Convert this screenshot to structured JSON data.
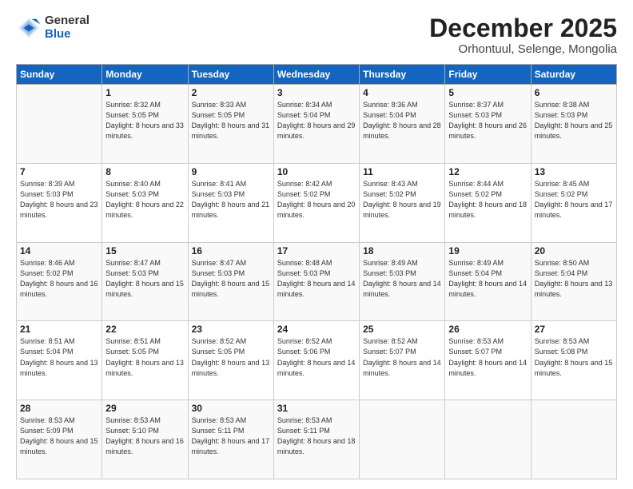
{
  "header": {
    "logo": {
      "line1": "General",
      "line2": "Blue"
    },
    "title": "December 2025",
    "subtitle": "Orhontuul, Selenge, Mongolia"
  },
  "days_header": [
    "Sunday",
    "Monday",
    "Tuesday",
    "Wednesday",
    "Thursday",
    "Friday",
    "Saturday"
  ],
  "weeks": [
    [
      {
        "day": "",
        "sunrise": "",
        "sunset": "",
        "daylight": ""
      },
      {
        "day": "1",
        "sunrise": "Sunrise: 8:32 AM",
        "sunset": "Sunset: 5:05 PM",
        "daylight": "Daylight: 8 hours and 33 minutes."
      },
      {
        "day": "2",
        "sunrise": "Sunrise: 8:33 AM",
        "sunset": "Sunset: 5:05 PM",
        "daylight": "Daylight: 8 hours and 31 minutes."
      },
      {
        "day": "3",
        "sunrise": "Sunrise: 8:34 AM",
        "sunset": "Sunset: 5:04 PM",
        "daylight": "Daylight: 8 hours and 29 minutes."
      },
      {
        "day": "4",
        "sunrise": "Sunrise: 8:36 AM",
        "sunset": "Sunset: 5:04 PM",
        "daylight": "Daylight: 8 hours and 28 minutes."
      },
      {
        "day": "5",
        "sunrise": "Sunrise: 8:37 AM",
        "sunset": "Sunset: 5:03 PM",
        "daylight": "Daylight: 8 hours and 26 minutes."
      },
      {
        "day": "6",
        "sunrise": "Sunrise: 8:38 AM",
        "sunset": "Sunset: 5:03 PM",
        "daylight": "Daylight: 8 hours and 25 minutes."
      }
    ],
    [
      {
        "day": "7",
        "sunrise": "Sunrise: 8:39 AM",
        "sunset": "Sunset: 5:03 PM",
        "daylight": "Daylight: 8 hours and 23 minutes."
      },
      {
        "day": "8",
        "sunrise": "Sunrise: 8:40 AM",
        "sunset": "Sunset: 5:03 PM",
        "daylight": "Daylight: 8 hours and 22 minutes."
      },
      {
        "day": "9",
        "sunrise": "Sunrise: 8:41 AM",
        "sunset": "Sunset: 5:03 PM",
        "daylight": "Daylight: 8 hours and 21 minutes."
      },
      {
        "day": "10",
        "sunrise": "Sunrise: 8:42 AM",
        "sunset": "Sunset: 5:02 PM",
        "daylight": "Daylight: 8 hours and 20 minutes."
      },
      {
        "day": "11",
        "sunrise": "Sunrise: 8:43 AM",
        "sunset": "Sunset: 5:02 PM",
        "daylight": "Daylight: 8 hours and 19 minutes."
      },
      {
        "day": "12",
        "sunrise": "Sunrise: 8:44 AM",
        "sunset": "Sunset: 5:02 PM",
        "daylight": "Daylight: 8 hours and 18 minutes."
      },
      {
        "day": "13",
        "sunrise": "Sunrise: 8:45 AM",
        "sunset": "Sunset: 5:02 PM",
        "daylight": "Daylight: 8 hours and 17 minutes."
      }
    ],
    [
      {
        "day": "14",
        "sunrise": "Sunrise: 8:46 AM",
        "sunset": "Sunset: 5:02 PM",
        "daylight": "Daylight: 8 hours and 16 minutes."
      },
      {
        "day": "15",
        "sunrise": "Sunrise: 8:47 AM",
        "sunset": "Sunset: 5:03 PM",
        "daylight": "Daylight: 8 hours and 15 minutes."
      },
      {
        "day": "16",
        "sunrise": "Sunrise: 8:47 AM",
        "sunset": "Sunset: 5:03 PM",
        "daylight": "Daylight: 8 hours and 15 minutes."
      },
      {
        "day": "17",
        "sunrise": "Sunrise: 8:48 AM",
        "sunset": "Sunset: 5:03 PM",
        "daylight": "Daylight: 8 hours and 14 minutes."
      },
      {
        "day": "18",
        "sunrise": "Sunrise: 8:49 AM",
        "sunset": "Sunset: 5:03 PM",
        "daylight": "Daylight: 8 hours and 14 minutes."
      },
      {
        "day": "19",
        "sunrise": "Sunrise: 8:49 AM",
        "sunset": "Sunset: 5:04 PM",
        "daylight": "Daylight: 8 hours and 14 minutes."
      },
      {
        "day": "20",
        "sunrise": "Sunrise: 8:50 AM",
        "sunset": "Sunset: 5:04 PM",
        "daylight": "Daylight: 8 hours and 13 minutes."
      }
    ],
    [
      {
        "day": "21",
        "sunrise": "Sunrise: 8:51 AM",
        "sunset": "Sunset: 5:04 PM",
        "daylight": "Daylight: 8 hours and 13 minutes."
      },
      {
        "day": "22",
        "sunrise": "Sunrise: 8:51 AM",
        "sunset": "Sunset: 5:05 PM",
        "daylight": "Daylight: 8 hours and 13 minutes."
      },
      {
        "day": "23",
        "sunrise": "Sunrise: 8:52 AM",
        "sunset": "Sunset: 5:05 PM",
        "daylight": "Daylight: 8 hours and 13 minutes."
      },
      {
        "day": "24",
        "sunrise": "Sunrise: 8:52 AM",
        "sunset": "Sunset: 5:06 PM",
        "daylight": "Daylight: 8 hours and 14 minutes."
      },
      {
        "day": "25",
        "sunrise": "Sunrise: 8:52 AM",
        "sunset": "Sunset: 5:07 PM",
        "daylight": "Daylight: 8 hours and 14 minutes."
      },
      {
        "day": "26",
        "sunrise": "Sunrise: 8:53 AM",
        "sunset": "Sunset: 5:07 PM",
        "daylight": "Daylight: 8 hours and 14 minutes."
      },
      {
        "day": "27",
        "sunrise": "Sunrise: 8:53 AM",
        "sunset": "Sunset: 5:08 PM",
        "daylight": "Daylight: 8 hours and 15 minutes."
      }
    ],
    [
      {
        "day": "28",
        "sunrise": "Sunrise: 8:53 AM",
        "sunset": "Sunset: 5:09 PM",
        "daylight": "Daylight: 8 hours and 15 minutes."
      },
      {
        "day": "29",
        "sunrise": "Sunrise: 8:53 AM",
        "sunset": "Sunset: 5:10 PM",
        "daylight": "Daylight: 8 hours and 16 minutes."
      },
      {
        "day": "30",
        "sunrise": "Sunrise: 8:53 AM",
        "sunset": "Sunset: 5:11 PM",
        "daylight": "Daylight: 8 hours and 17 minutes."
      },
      {
        "day": "31",
        "sunrise": "Sunrise: 8:53 AM",
        "sunset": "Sunset: 5:11 PM",
        "daylight": "Daylight: 8 hours and 18 minutes."
      },
      {
        "day": "",
        "sunrise": "",
        "sunset": "",
        "daylight": ""
      },
      {
        "day": "",
        "sunrise": "",
        "sunset": "",
        "daylight": ""
      },
      {
        "day": "",
        "sunrise": "",
        "sunset": "",
        "daylight": ""
      }
    ]
  ]
}
